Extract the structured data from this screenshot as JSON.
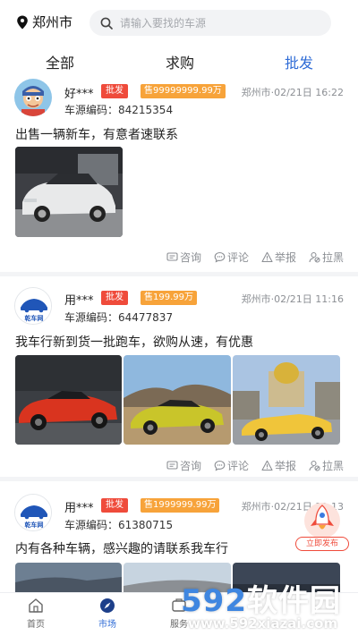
{
  "header": {
    "city": "郑州市",
    "search_placeholder": "请输入要找的车源"
  },
  "tabs": [
    {
      "label": "全部",
      "active": false
    },
    {
      "label": "求购",
      "active": false
    },
    {
      "label": "批发",
      "active": true
    }
  ],
  "posts": [
    {
      "user": "好***",
      "type_tag": "批发",
      "price_tag": "售99999999.99万",
      "location_time": "郑州市·02/21日 16:22",
      "code": "车源编码：84215354",
      "desc": "出售一辆新车，有意者速联系"
    },
    {
      "user": "用***",
      "avatar_text": "乾车网",
      "type_tag": "批发",
      "price_tag": "售199.99万",
      "location_time": "郑州市·02/21日 11:16",
      "code": "车源编码：64477837",
      "desc": "我车行新到货一批跑车，欲购从速，有优惠"
    },
    {
      "user": "用***",
      "avatar_text": "乾车网",
      "type_tag": "批发",
      "price_tag": "售1999999.99万",
      "location_time": "郑州市·02/21日 11:13",
      "code": "车源编码：61380715",
      "desc": "内有各种车辆，感兴趣的请联系我车行"
    }
  ],
  "actions": {
    "consult": "咨询",
    "comment": "评论",
    "report": "举报",
    "block": "拉黑"
  },
  "fab": {
    "label": "立即发布"
  },
  "bottom_nav": [
    {
      "label": "首页",
      "active": false
    },
    {
      "label": "市场",
      "active": true
    },
    {
      "label": "服务",
      "active": false
    }
  ],
  "watermark": {
    "brand_digits": "592",
    "brand_text": "软件园",
    "url": "www.592xiazai.com"
  },
  "colors": {
    "accent": "#2e6bd6",
    "tag_red": "#ef4b3b",
    "tag_orange": "#f7a33a"
  }
}
